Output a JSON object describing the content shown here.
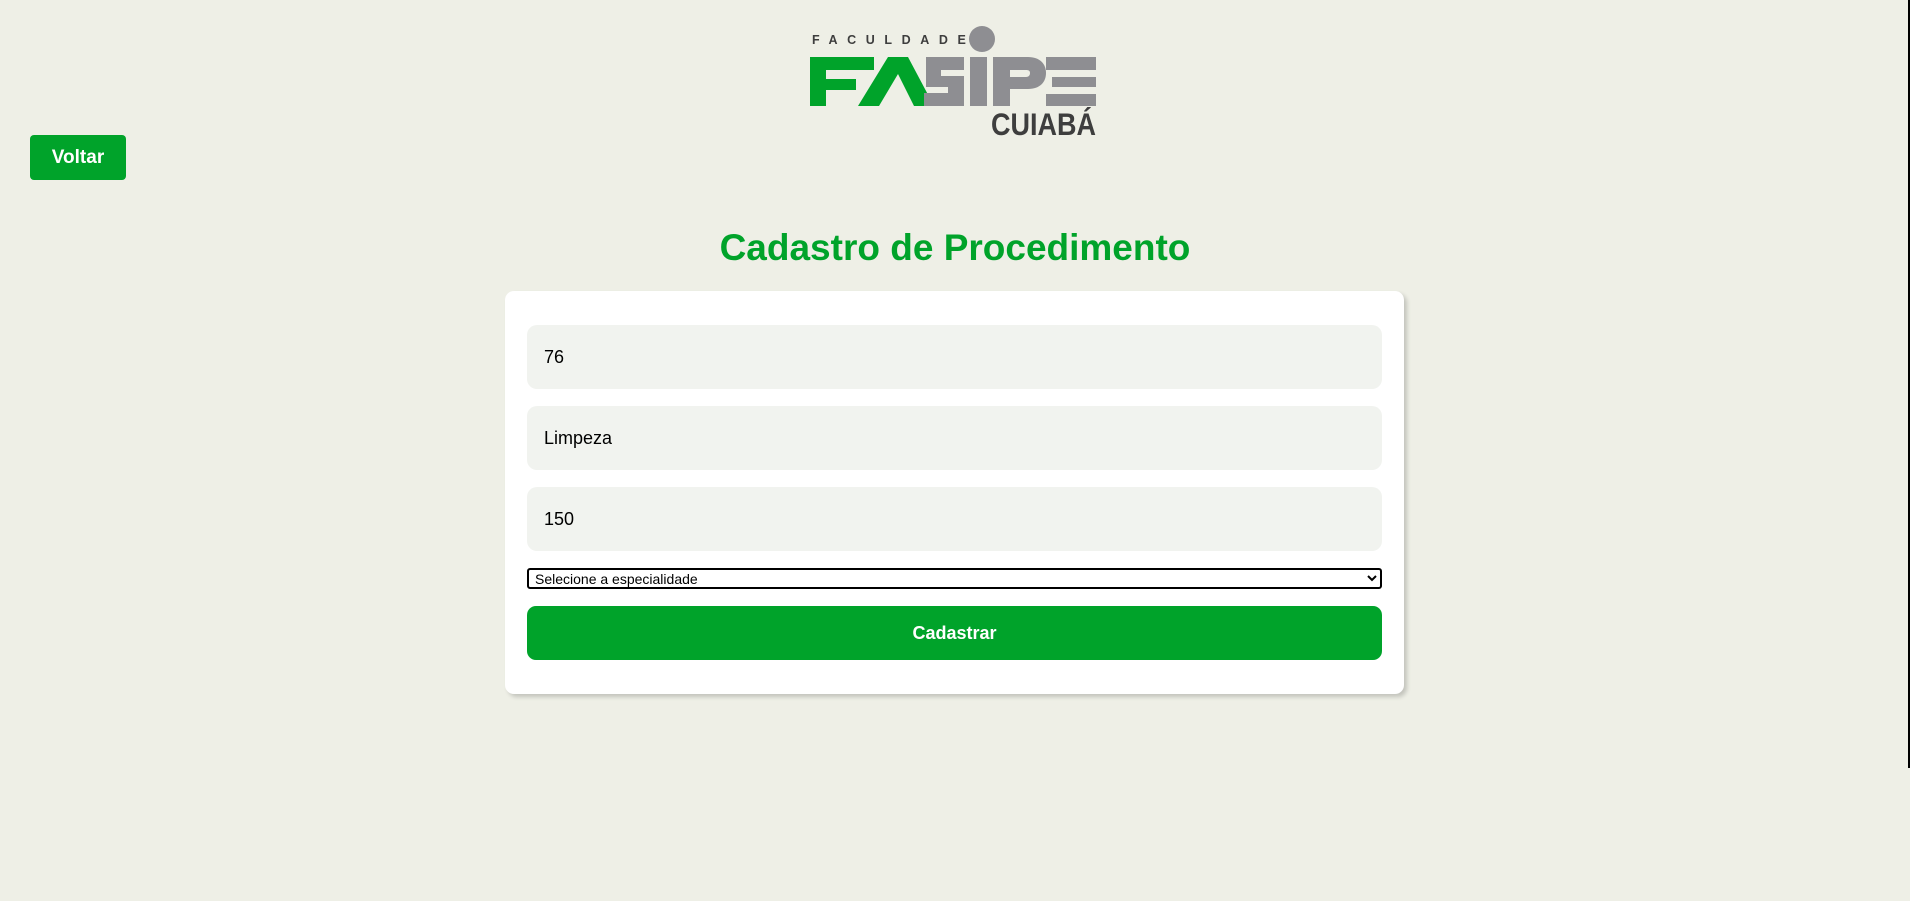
{
  "logo": {
    "top_text": "FACULDADE",
    "brand": "FASIPE",
    "city": "CUIABÁ"
  },
  "nav": {
    "back_label": "Voltar"
  },
  "page": {
    "title": "Cadastro de Procedimento"
  },
  "form": {
    "codigo_value": "76",
    "nome_value": "Limpeza",
    "valor_value": "150",
    "especialidade_selected": "Selecione a especialidade",
    "submit_label": "Cadastrar"
  },
  "colors": {
    "background": "#eeefe6",
    "accent_green": "#00a32a",
    "logo_gray": "#8e8e92",
    "field_bg": "#f1f3ef"
  }
}
